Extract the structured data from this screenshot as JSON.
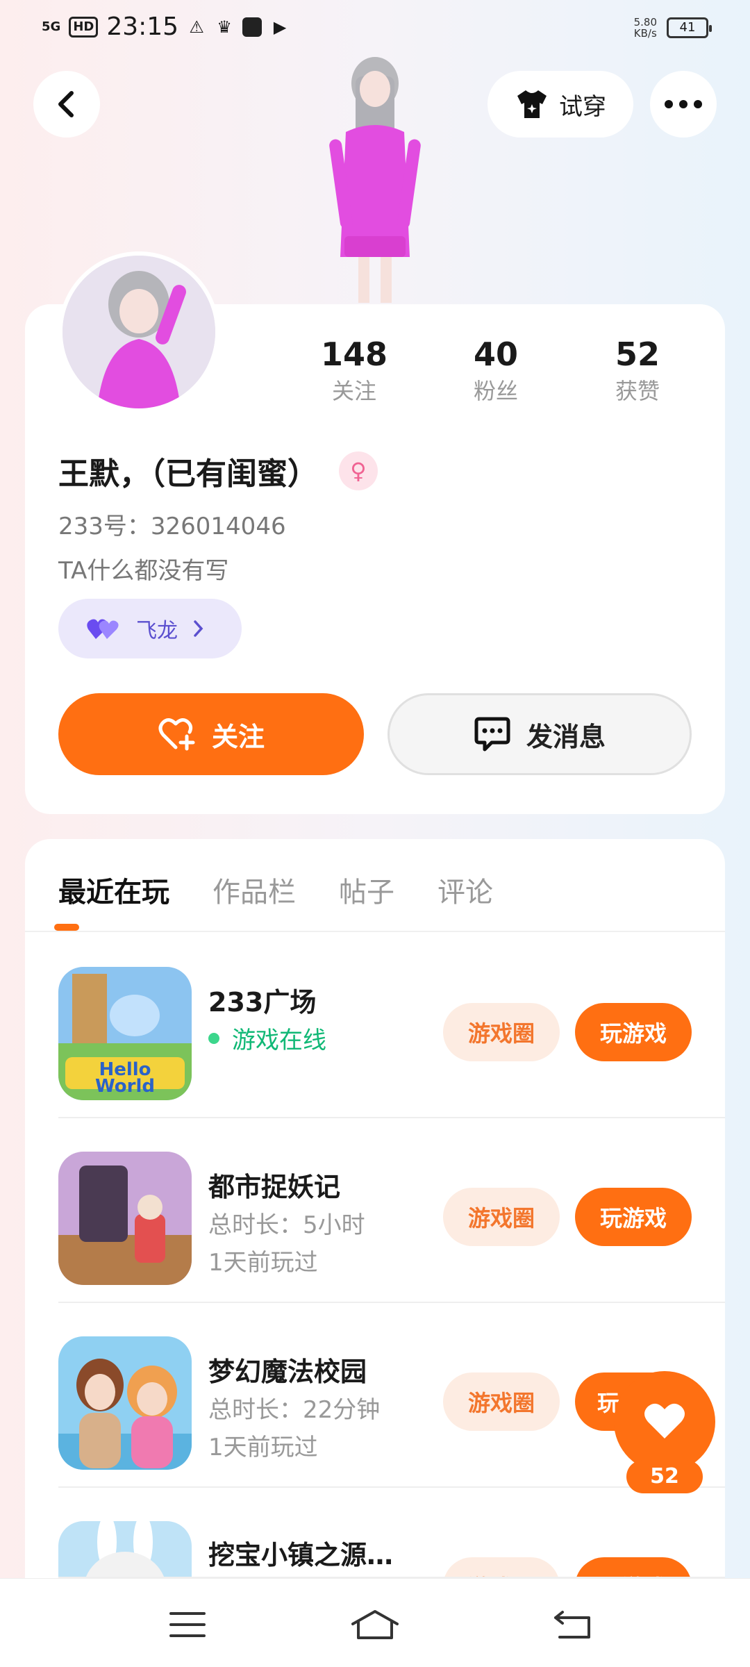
{
  "status_bar": {
    "network": "5G",
    "hd": "HD",
    "time": "23:15",
    "speed_top": "5.80",
    "speed_unit": "KB/s",
    "battery": "41"
  },
  "header": {
    "tryon_label": "试穿"
  },
  "profile": {
    "following_count": "148",
    "following_label": "关注",
    "followers_count": "40",
    "followers_label": "粉丝",
    "likes_count": "52",
    "likes_label": "获赞",
    "username": "王默，（已有闺蜜）",
    "gender_icon": "female-icon",
    "uid": "233号：326014046",
    "bio": "TA什么都没有写",
    "tag_label": "飞龙",
    "follow_label": "关注",
    "message_label": "发消息"
  },
  "tabs": [
    {
      "label": "最近在玩",
      "active": true
    },
    {
      "label": "作品栏",
      "active": false
    },
    {
      "label": "帖子",
      "active": false
    },
    {
      "label": "评论",
      "active": false
    }
  ],
  "games": [
    {
      "title": "233广场",
      "status": "游戏在线",
      "circle_label": "游戏圈",
      "play_label": "玩游戏"
    },
    {
      "title": "都市捉妖记",
      "duration": "总时长：5小时",
      "last_played": "1天前玩过",
      "circle_label": "游戏圈",
      "play_label": "玩游戏"
    },
    {
      "title": "梦幻魔法校园",
      "duration": "总时长：22分钟",
      "last_played": "1天前玩过",
      "circle_label": "游戏圈",
      "play_label": "玩"
    },
    {
      "title": "挖宝小镇之源…",
      "circle_label": "游戏圈",
      "play_label": "玩游戏"
    }
  ],
  "like_fab": {
    "count": "52"
  },
  "colors": {
    "accent": "#ff6f12",
    "online": "#11b876",
    "tag": "#5b4fcf"
  }
}
